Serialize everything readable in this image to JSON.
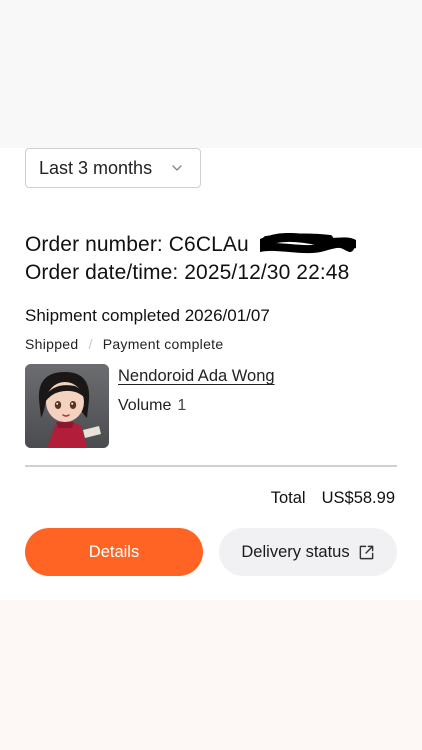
{
  "filter": {
    "selected": "Last 3 months",
    "icon": "chevron-down-icon"
  },
  "order": {
    "number_label": "Order number: ",
    "number_value": "C6CLAu",
    "date_label": "Order date/time: ",
    "date_value": "2025/12/30 22:48"
  },
  "shipment": {
    "text": "Shipment completed 2026/01/07",
    "status_shipped": "Shipped",
    "separator": "/",
    "status_payment": "Payment complete"
  },
  "item": {
    "name": "Nendoroid Ada Wong",
    "volume_label": "Volume",
    "volume_qty": "1"
  },
  "summary": {
    "total_label": "Total",
    "total_amount": "US$58.99"
  },
  "actions": {
    "details_label": "Details",
    "delivery_label": "Delivery status",
    "delivery_icon": "external-link-icon"
  },
  "colors": {
    "accent": "#ff6424",
    "secondary_button": "#f1f1f3",
    "divider": "#d0d0d4"
  }
}
